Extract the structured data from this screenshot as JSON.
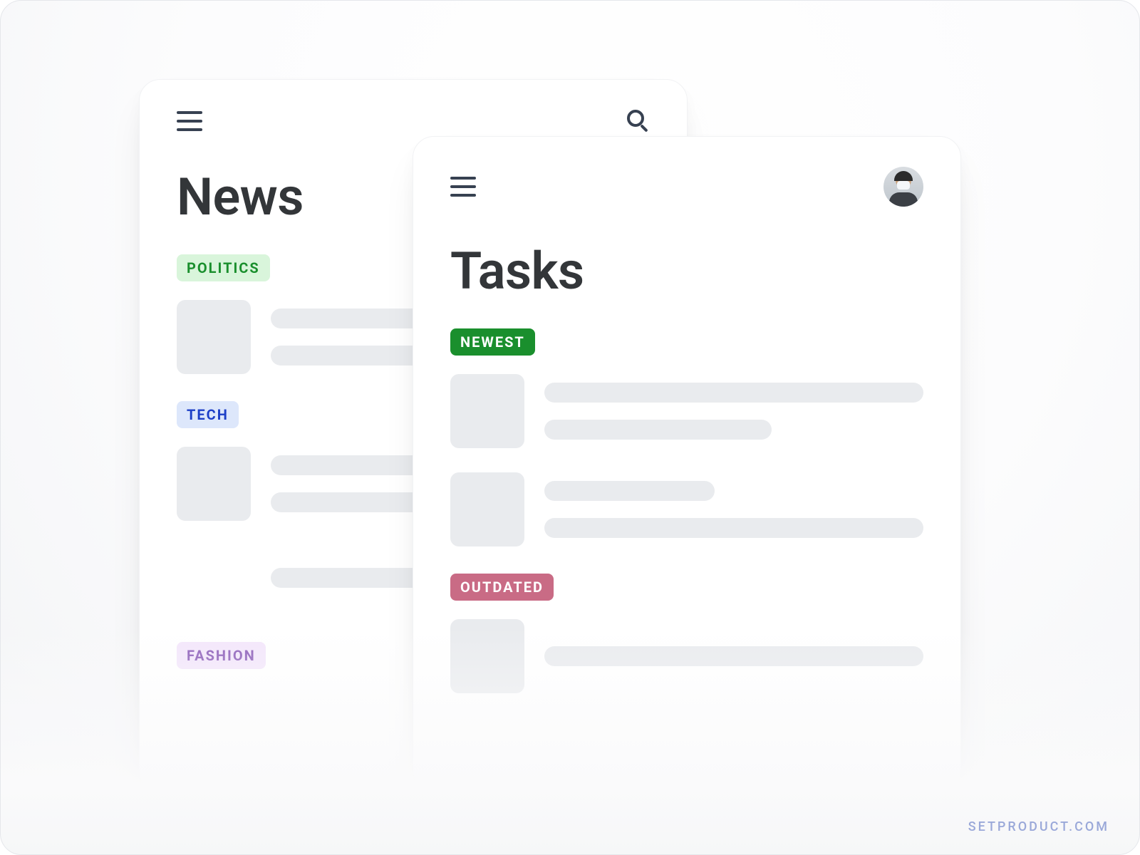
{
  "watermark": "SETPRODUCT.COM",
  "cards": {
    "news": {
      "title": "News",
      "tags": {
        "politics": {
          "label": "POLITICS",
          "style": "green-light"
        },
        "tech": {
          "label": "TECH",
          "style": "blue-light"
        },
        "fashion": {
          "label": "FASHION",
          "style": "purple-light"
        }
      }
    },
    "tasks": {
      "title": "Tasks",
      "tags": {
        "newest": {
          "label": "NEWEST",
          "style": "green-solid"
        },
        "outdated": {
          "label": "OUTDATED",
          "style": "pink-solid"
        }
      }
    }
  }
}
